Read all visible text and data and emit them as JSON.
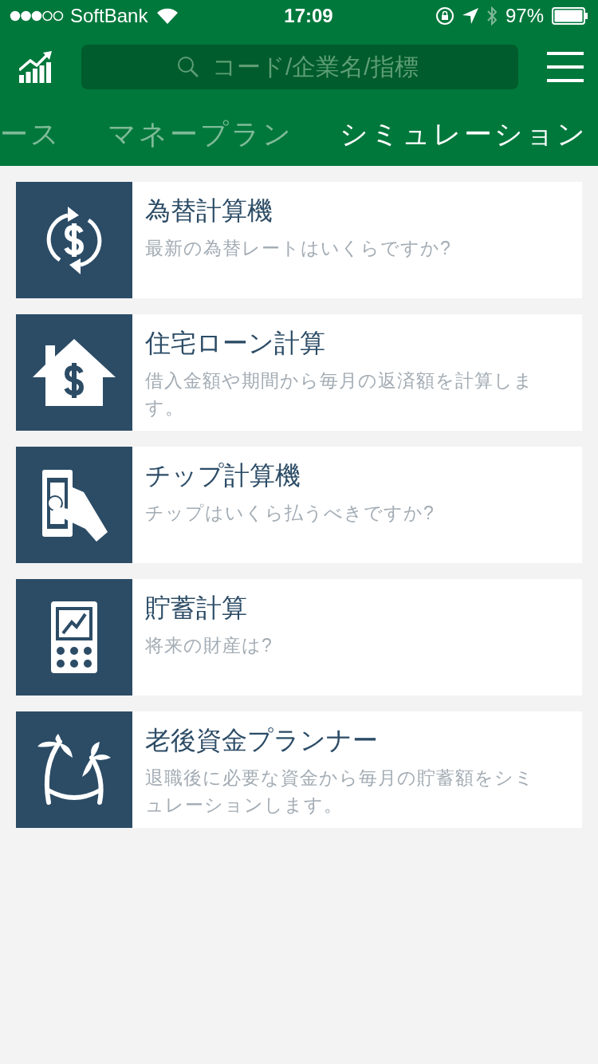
{
  "status_bar": {
    "carrier": "SoftBank",
    "time": "17:09",
    "battery": "97%"
  },
  "header": {
    "search": {
      "placeholder": "コード/企業名/指標"
    }
  },
  "tabs": [
    {
      "label": "ース",
      "selected": false
    },
    {
      "label": "マネープラン",
      "selected": false
    },
    {
      "label": "シミュレーション",
      "selected": true
    }
  ],
  "items": [
    {
      "kind": "exchange",
      "title": "為替計算機",
      "subtitle": "最新の為替レートはいくらですか?"
    },
    {
      "kind": "mortgage",
      "title": "住宅ローン計算",
      "subtitle": "借入金額や期間から毎月の返済額を計算します。"
    },
    {
      "kind": "tip",
      "title": "チップ計算機",
      "subtitle": "チップはいくら払うべきですか?"
    },
    {
      "kind": "savings",
      "title": "貯蓄計算",
      "subtitle": "将来の財産は?"
    },
    {
      "kind": "retirement",
      "title": "老後資金プランナー",
      "subtitle": "退職後に必要な資金から毎月の貯蓄額をシミュレーションします。"
    }
  ]
}
